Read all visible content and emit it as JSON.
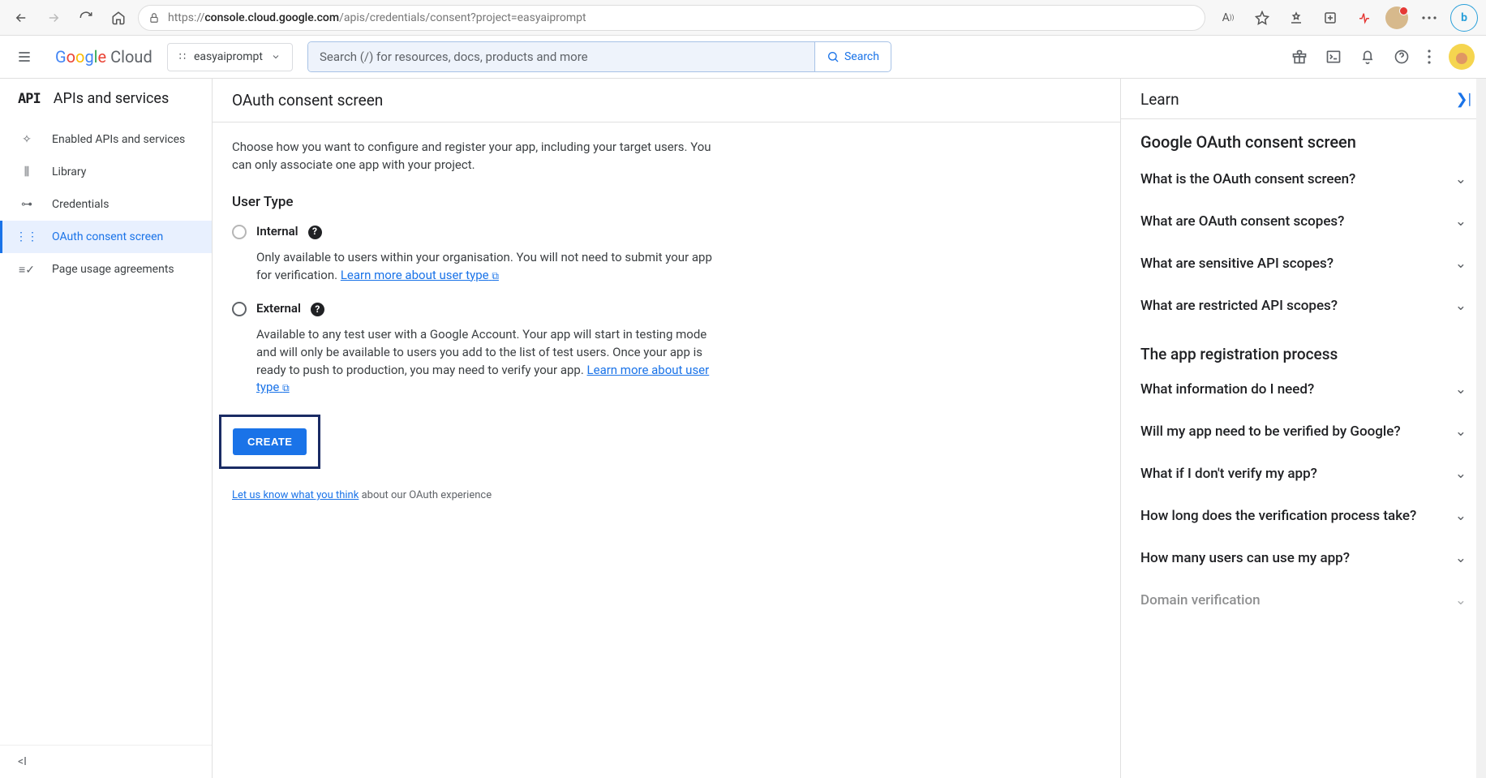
{
  "browser": {
    "url_host": "console.cloud.google.com",
    "url_path": "/apis/credentials/consent?project=easyaiprompt"
  },
  "gcp_header": {
    "logo_cloud": "Cloud",
    "project": "easyaiprompt",
    "search_placeholder": "Search (/) for resources, docs, products and more",
    "search_btn": "Search"
  },
  "sidenav": {
    "title": "APIs and services",
    "items": [
      {
        "label": "Enabled APIs and services"
      },
      {
        "label": "Library"
      },
      {
        "label": "Credentials"
      },
      {
        "label": "OAuth consent screen"
      },
      {
        "label": "Page usage agreements"
      }
    ]
  },
  "main": {
    "title": "OAuth consent screen",
    "intro": "Choose how you want to configure and register your app, including your target users. You can only associate one app with your project.",
    "user_type_heading": "User Type",
    "internal": {
      "label": "Internal",
      "desc": "Only available to users within your organisation. You will not need to submit your app for verification. ",
      "link": "Learn more about user type"
    },
    "external": {
      "label": "External",
      "desc": "Available to any test user with a Google Account. Your app will start in testing mode and will only be available to users you add to the list of test users. Once your app is ready to push to production, you may need to verify your app. ",
      "link": "Learn more about user type"
    },
    "create_btn": "CREATE",
    "feedback_link": "Let us know what you think",
    "feedback_tail": " about our OAuth experience"
  },
  "learn": {
    "title": "Learn",
    "section1": "Google OAuth consent screen",
    "items1": [
      "What is the OAuth consent screen?",
      "What are OAuth consent scopes?",
      "What are sensitive API scopes?",
      "What are restricted API scopes?"
    ],
    "section2": "The app registration process",
    "items2": [
      "What information do I need?",
      "Will my app need to be verified by Google?",
      "What if I don't verify my app?",
      "How long does the verification process take?",
      "How many users can use my app?",
      "Domain verification"
    ]
  }
}
